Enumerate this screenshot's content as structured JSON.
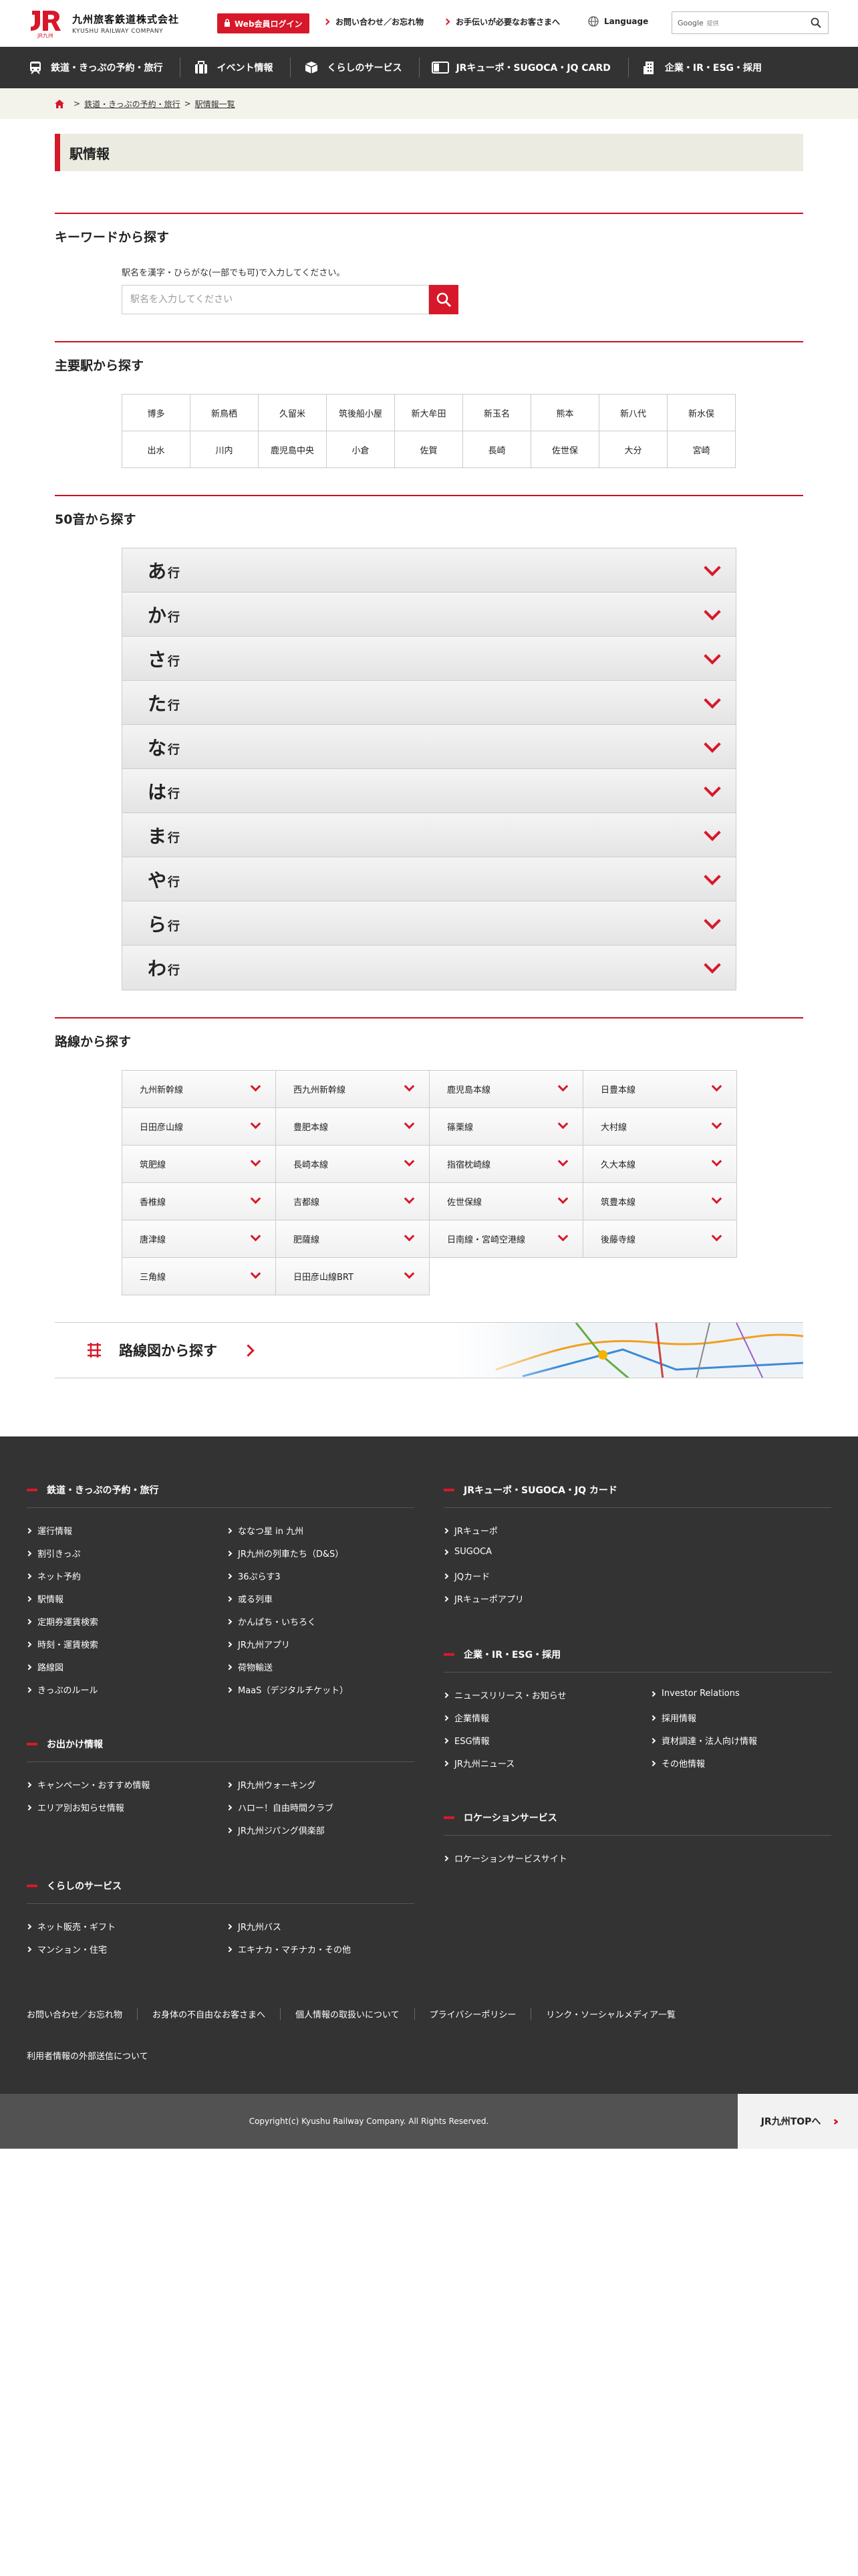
{
  "header": {
    "logo_jp": "九州旅客鉄道株式会社",
    "logo_en": "KYUSHU RAILWAY COMPANY",
    "logo_mark_text": "JR九州",
    "web_login": "Web会員ログイン",
    "link_inquiry": "お問い合わせ／お忘れ物",
    "link_assist": "お手伝いが必要なお客さまへ",
    "language": "Language",
    "search_brand": "Google",
    "search_sub": "提供"
  },
  "nav": {
    "items": [
      {
        "label": "鉄道・きっぷの予約・旅行",
        "icon": "train-icon"
      },
      {
        "label": "イベント情報",
        "icon": "bag-icon"
      },
      {
        "label": "くらしのサービス",
        "icon": "box-icon"
      },
      {
        "label": "JRキューポ・SUGOCA・JQ CARD",
        "icon": "card-icon"
      },
      {
        "label": "企業・IR・ESG・採用",
        "icon": "building-icon"
      }
    ]
  },
  "breadcrumb": {
    "item1": "鉄道・きっぷの予約・旅行",
    "sep": ">",
    "item2": "駅情報一覧"
  },
  "page": {
    "title": "駅情報"
  },
  "keyword": {
    "heading": "キーワードから探す",
    "help": "駅名を漢字・ひらがな(一部でも可)で入力してください。",
    "placeholder": "駅名を入力してください"
  },
  "major": {
    "heading": "主要駅から探す",
    "stations": [
      "博多",
      "新鳥栖",
      "久留米",
      "筑後船小屋",
      "新大牟田",
      "新玉名",
      "熊本",
      "新八代",
      "新水俣",
      "出水",
      "川内",
      "鹿児島中央",
      "小倉",
      "佐賀",
      "長崎",
      "佐世保",
      "大分",
      "宮崎"
    ]
  },
  "kana": {
    "heading": "50音から探す",
    "rows": [
      {
        "kana": "あ",
        "gyo": "行"
      },
      {
        "kana": "か",
        "gyo": "行"
      },
      {
        "kana": "さ",
        "gyo": "行"
      },
      {
        "kana": "た",
        "gyo": "行"
      },
      {
        "kana": "な",
        "gyo": "行"
      },
      {
        "kana": "は",
        "gyo": "行"
      },
      {
        "kana": "ま",
        "gyo": "行"
      },
      {
        "kana": "や",
        "gyo": "行"
      },
      {
        "kana": "ら",
        "gyo": "行"
      },
      {
        "kana": "わ",
        "gyo": "行"
      }
    ]
  },
  "lines": {
    "heading": "路線から探す",
    "items": [
      "九州新幹線",
      "西九州新幹線",
      "鹿児島本線",
      "日豊本線",
      "日田彦山線",
      "豊肥本線",
      "篠栗線",
      "大村線",
      "筑肥線",
      "長崎本線",
      "指宿枕崎線",
      "久大本線",
      "香椎線",
      "吉都線",
      "佐世保線",
      "筑豊本線",
      "唐津線",
      "肥薩線",
      "日南線・宮崎空港線",
      "後藤寺線",
      "三角線",
      "日田彦山線BRT"
    ]
  },
  "map": {
    "label": "路線図から探す"
  },
  "footer": {
    "rail": {
      "heading": "鉄道・きっぷの予約・旅行",
      "col1": [
        "運行情報",
        "割引きっぷ",
        "ネット予約",
        "駅情報",
        "定期券運賃検索",
        "時刻・運賃検索",
        "路線図",
        "きっぷのルール"
      ],
      "col2": [
        "ななつ星 in 九州",
        "JR九州の列車たち（D&S）",
        "36ぷらす3",
        "或る列車",
        "かんぱち・いちろく",
        "JR九州アプリ",
        "荷物輸送",
        "MaaS（デジタルチケット）"
      ]
    },
    "outing": {
      "heading": "お出かけ情報",
      "col1": [
        "キャンペーン・おすすめ情報",
        "エリア別お知らせ情報"
      ],
      "col2": [
        "JR九州ウォーキング",
        "ハロー！自由時間クラブ",
        "JR九州ジパング倶楽部"
      ]
    },
    "life": {
      "heading": "くらしのサービス",
      "col1": [
        "ネット販売・ギフト",
        "マンション・住宅"
      ],
      "col2": [
        "JR九州バス",
        "エキナカ・マチナカ・その他"
      ]
    },
    "card": {
      "heading": "JRキューポ・SUGOCA・JQ カード",
      "col1": [
        "JRキューポ",
        "SUGOCA",
        "JQカード",
        "JRキューポアプリ"
      ]
    },
    "corp": {
      "heading": "企業・IR・ESG・採用",
      "col1": [
        "ニュースリリース・お知らせ",
        "企業情報",
        "ESG情報",
        "JR九州ニュース"
      ],
      "col2": [
        "Investor Relations",
        "採用情報",
        "資材調達・法人向け情報",
        "その他情報"
      ]
    },
    "loc": {
      "heading": "ロケーションサービス",
      "col1": [
        "ロケーションサービスサイト"
      ]
    },
    "bottom": [
      "お問い合わせ／お忘れ物",
      "お身体の不自由なお客さまへ",
      "個人情報の取扱いについて",
      "プライバシーポリシー",
      "リンク・ソーシャルメディア一覧"
    ],
    "bottom2": "利用者情報の外部送信について",
    "copyright": "Copyright(c) Kyushu Railway Company. All Rights Reserved.",
    "totop": "JR九州TOPへ"
  }
}
